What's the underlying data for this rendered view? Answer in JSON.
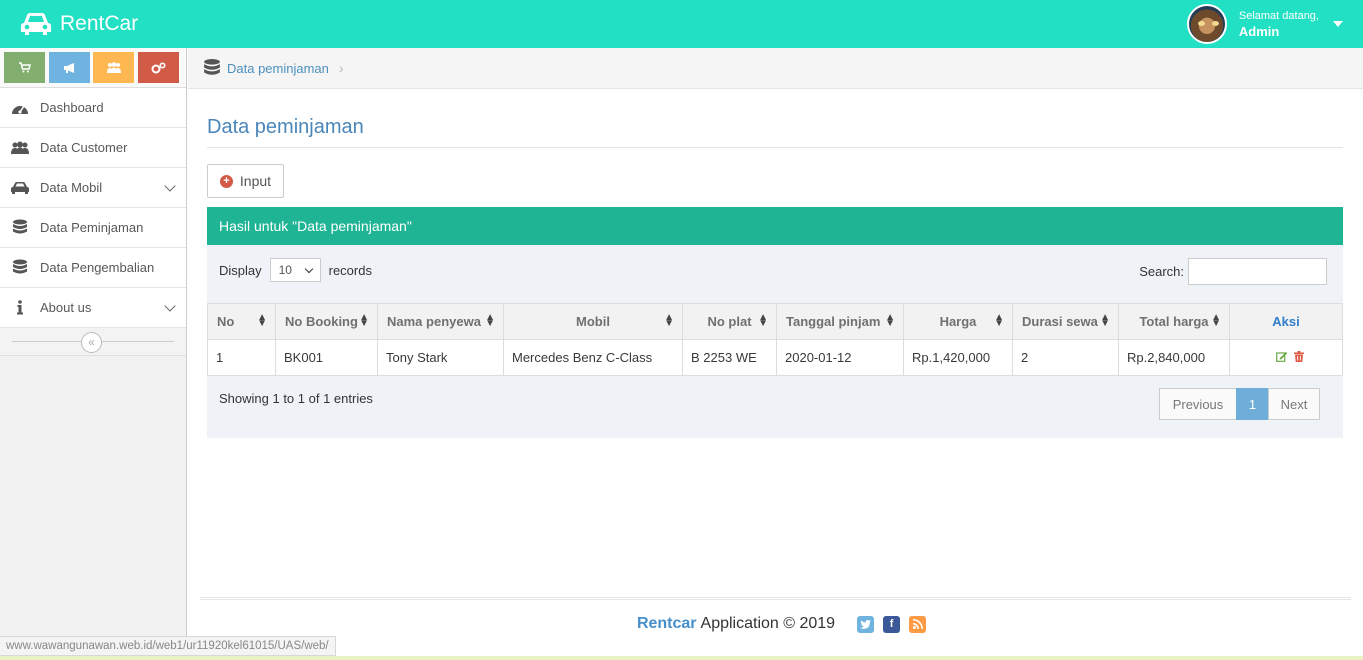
{
  "app": {
    "name": "RentCar"
  },
  "user": {
    "greeting": "Selamat datang,",
    "name": "Admin"
  },
  "sidebar": {
    "shortcuts": [
      {
        "icon": "cart-icon",
        "color": "#82af6f"
      },
      {
        "icon": "bullhorn-icon",
        "color": "#6fb3e0"
      },
      {
        "icon": "users-icon",
        "color": "#ffb752"
      },
      {
        "icon": "cogs-icon",
        "color": "#d15b47"
      }
    ],
    "items": [
      {
        "label": "Dashboard",
        "icon": "tachometer-icon"
      },
      {
        "label": "Data Customer",
        "icon": "users-icon"
      },
      {
        "label": "Data Mobil",
        "icon": "car-icon"
      },
      {
        "label": "Data Peminjaman",
        "icon": "database-icon"
      },
      {
        "label": "Data Pengembalian",
        "icon": "database-icon"
      },
      {
        "label": "About us",
        "icon": "info-icon"
      }
    ],
    "collapse_glyph": "«"
  },
  "breadcrumb": {
    "label": "Data peminjaman",
    "separator": "›"
  },
  "page": {
    "title": "Data peminjaman",
    "input_button": "Input",
    "panel_title": "Hasil untuk \"Data peminjaman\""
  },
  "table": {
    "display_label": "Display",
    "display_value": "10",
    "records_label": "records",
    "search_label": "Search:",
    "headers": [
      "No",
      "No Booking",
      "Nama penyewa",
      "Mobil",
      "No plat",
      "Tanggal pinjam",
      "Harga",
      "Durasi sewa",
      "Total harga",
      "Aksi"
    ],
    "rows": [
      [
        "1",
        "BK001",
        "Tony Stark",
        "Mercedes Benz C-Class",
        "B 2253 WE",
        "2020-01-12",
        "Rp.1,420,000",
        "2",
        "Rp.2,840,000"
      ]
    ],
    "info": "Showing 1 to 1 of 1 entries",
    "pager": {
      "previous": "Previous",
      "current": "1",
      "next": "Next"
    }
  },
  "footer": {
    "brand": "Rentcar",
    "text": "Application © 2019",
    "social": [
      "twitter-icon",
      "facebook-icon",
      "rss-icon"
    ]
  },
  "statusbar": {
    "url": "www.wawangunawan.web.id/web1/ur11920kel61015/UAS/web/"
  },
  "colors": {
    "navbar": "#22e0c4",
    "panel_header": "#1fb493",
    "title": "#4a86b8"
  }
}
